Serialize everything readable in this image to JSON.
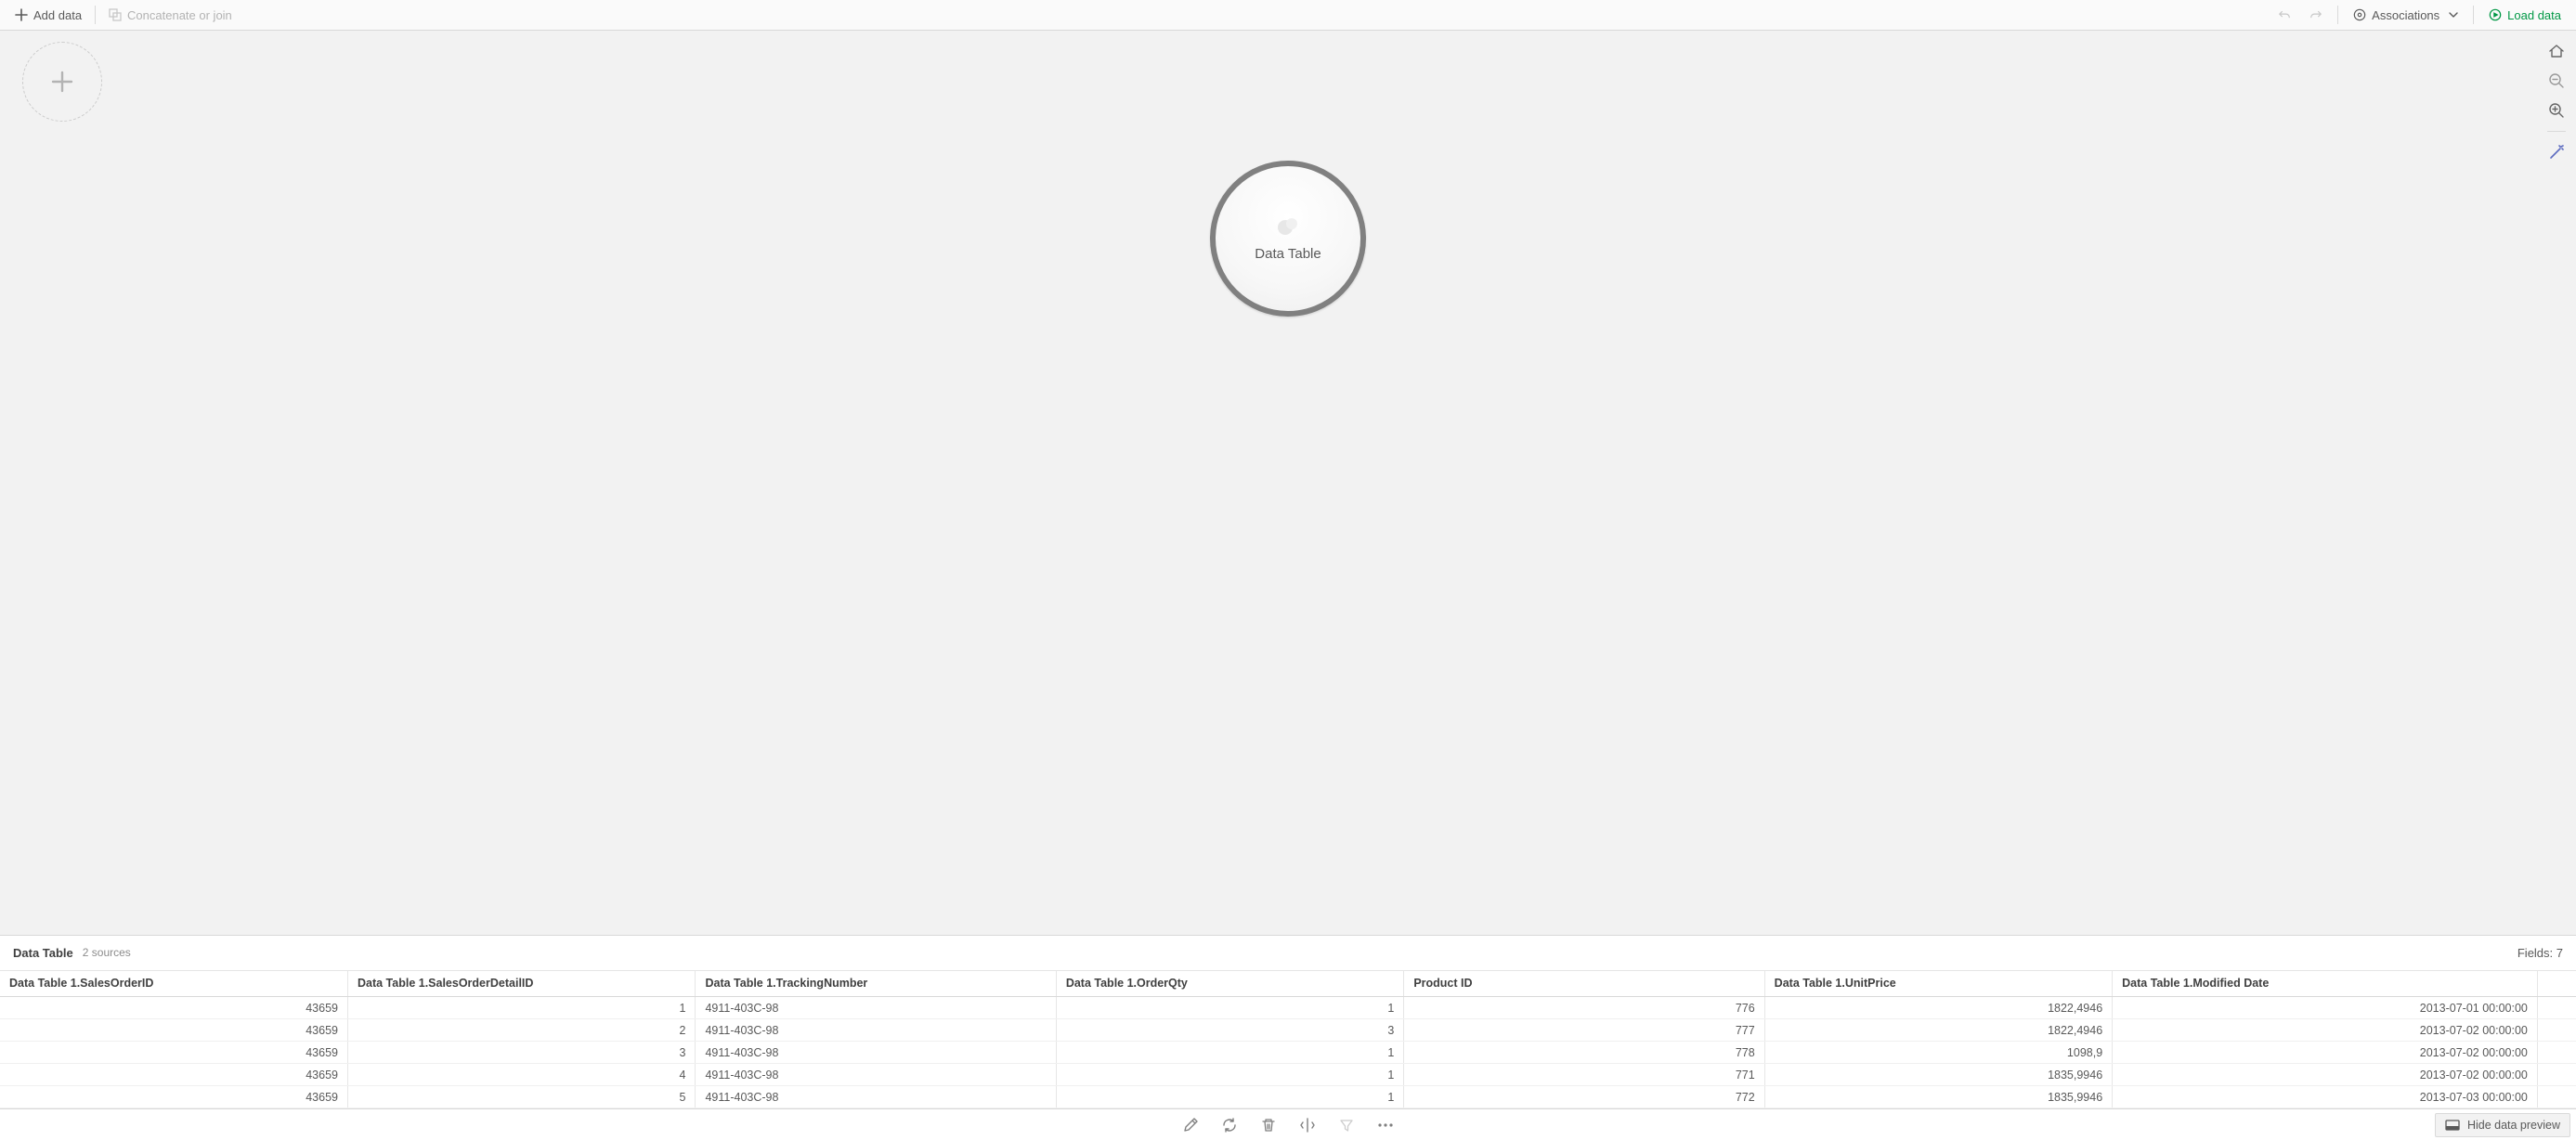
{
  "toolbar": {
    "add_data_label": "Add data",
    "concat_label": "Concatenate or join",
    "associations_label": "Associations",
    "load_data_label": "Load data"
  },
  "canvas": {
    "bubble_label": "Data Table"
  },
  "preview_header": {
    "title": "Data Table",
    "subtitle": "2 sources",
    "fields_label": "Fields: 7"
  },
  "table": {
    "columns": [
      {
        "label": "Data Table 1.SalesOrderID",
        "align": "num"
      },
      {
        "label": "Data Table 1.SalesOrderDetailID",
        "align": "num"
      },
      {
        "label": "Data Table 1.TrackingNumber",
        "align": "txt"
      },
      {
        "label": "Data Table 1.OrderQty",
        "align": "num"
      },
      {
        "label": "Product ID",
        "align": "num"
      },
      {
        "label": "Data Table 1.UnitPrice",
        "align": "num"
      },
      {
        "label": "Data Table 1.Modified Date",
        "align": "num"
      }
    ],
    "rows": [
      [
        "43659",
        "1",
        "4911-403C-98",
        "1",
        "776",
        "1822,4946",
        "2013-07-01 00:00:00"
      ],
      [
        "43659",
        "2",
        "4911-403C-98",
        "3",
        "777",
        "1822,4946",
        "2013-07-02 00:00:00"
      ],
      [
        "43659",
        "3",
        "4911-403C-98",
        "1",
        "778",
        "1098,9",
        "2013-07-02 00:00:00"
      ],
      [
        "43659",
        "4",
        "4911-403C-98",
        "1",
        "771",
        "1835,9946",
        "2013-07-02 00:00:00"
      ],
      [
        "43659",
        "5",
        "4911-403C-98",
        "1",
        "772",
        "1835,9946",
        "2013-07-03 00:00:00"
      ]
    ]
  },
  "bottombar": {
    "hide_preview_label": "Hide data preview"
  }
}
